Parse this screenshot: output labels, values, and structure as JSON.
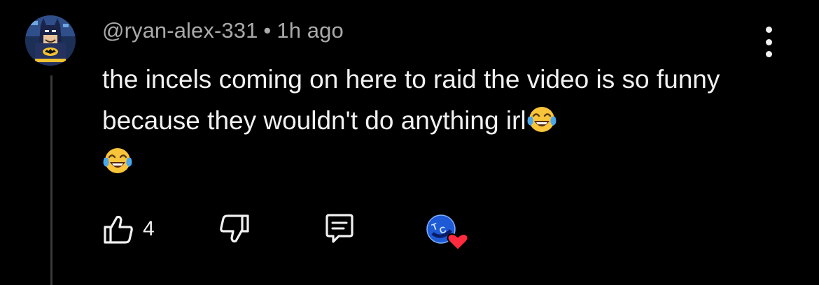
{
  "comment": {
    "author": "@ryan-alex-331",
    "separator": "•",
    "timestamp": "1h ago",
    "text": "the incels coming on here to raid the video is so funny because they wouldn't do anything irl",
    "emojis": [
      "face-with-tears-of-joy",
      "face-with-tears-of-joy"
    ],
    "like_count": "4",
    "creator_heart": {
      "badge_text": "TC",
      "heart_color": "#ff2a3d",
      "badge_color": "#1e5ad6"
    }
  },
  "icons": {
    "like": "thumbs-up-icon",
    "dislike": "thumbs-down-icon",
    "reply": "reply-comment-icon",
    "menu": "more-vert-icon"
  },
  "colors": {
    "background": "#000000",
    "text": "#f1f1f1",
    "meta": "#aaaaaa",
    "thread_line": "#3a3a3a"
  }
}
